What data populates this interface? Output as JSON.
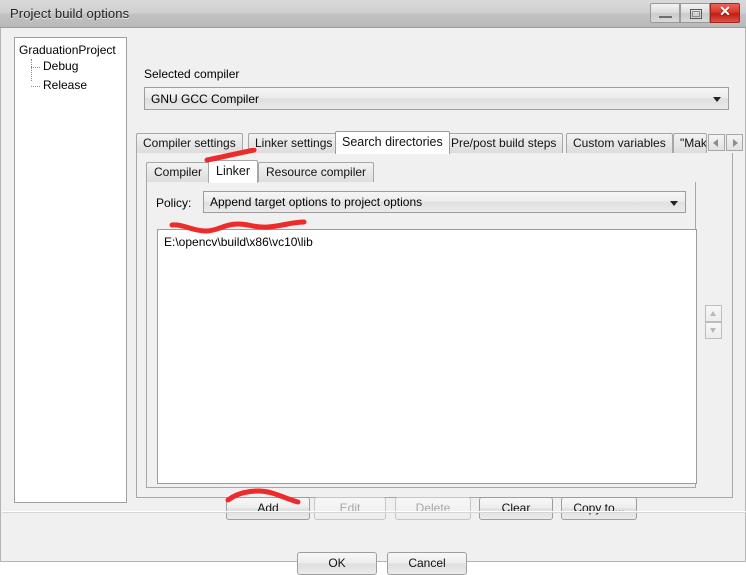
{
  "window": {
    "title": "Project build options",
    "controls": {
      "minimize": "minimize-button",
      "maximize": "maximize-button",
      "close_glyph": "✕"
    }
  },
  "tree": {
    "root": "GraduationProject",
    "children": [
      "Debug",
      "Release"
    ]
  },
  "compiler": {
    "group_label": "Selected compiler",
    "selected": "GNU GCC Compiler"
  },
  "tabs": {
    "items": [
      {
        "label": "Compiler settings",
        "active": false
      },
      {
        "label": "Linker settings",
        "active": false
      },
      {
        "label": "Search directories",
        "active": true
      },
      {
        "label": "Pre/post build steps",
        "active": false
      },
      {
        "label": "Custom variables",
        "active": false
      },
      {
        "label": "\"Mak",
        "active": false
      }
    ],
    "scroll_left": "◄",
    "scroll_right": "►"
  },
  "inner_tabs": {
    "items": [
      {
        "label": "Compiler",
        "active": false
      },
      {
        "label": "Linker",
        "active": true
      },
      {
        "label": "Resource compiler",
        "active": false
      }
    ]
  },
  "policy": {
    "label": "Policy:",
    "value": "Append target options to project options"
  },
  "directories": {
    "items": [
      "E:\\opencv\\build\\x86\\vc10\\lib"
    ]
  },
  "move_buttons": {
    "up": "move-up",
    "down": "move-down"
  },
  "actions": {
    "add": "Add",
    "edit": "Edit",
    "delete": "Delete",
    "clear": "Clear",
    "copy_to": "Copy to..."
  },
  "dialog_buttons": {
    "ok": "OK",
    "cancel": "Cancel"
  },
  "colors": {
    "dialog_bg": "#f0f0f0",
    "list_bg": "#ffffff",
    "close_red": "#d8372b",
    "annotation_red": "#ee2b2b",
    "border": "#a0a0a0"
  },
  "annotations": [
    {
      "name": "linker-tab-underline",
      "target": "Linker"
    },
    {
      "name": "directory-path-underline",
      "target": "E:\\opencv\\build\\x86\\vc10\\lib"
    },
    {
      "name": "add-button-underline",
      "target": "Add"
    }
  ]
}
